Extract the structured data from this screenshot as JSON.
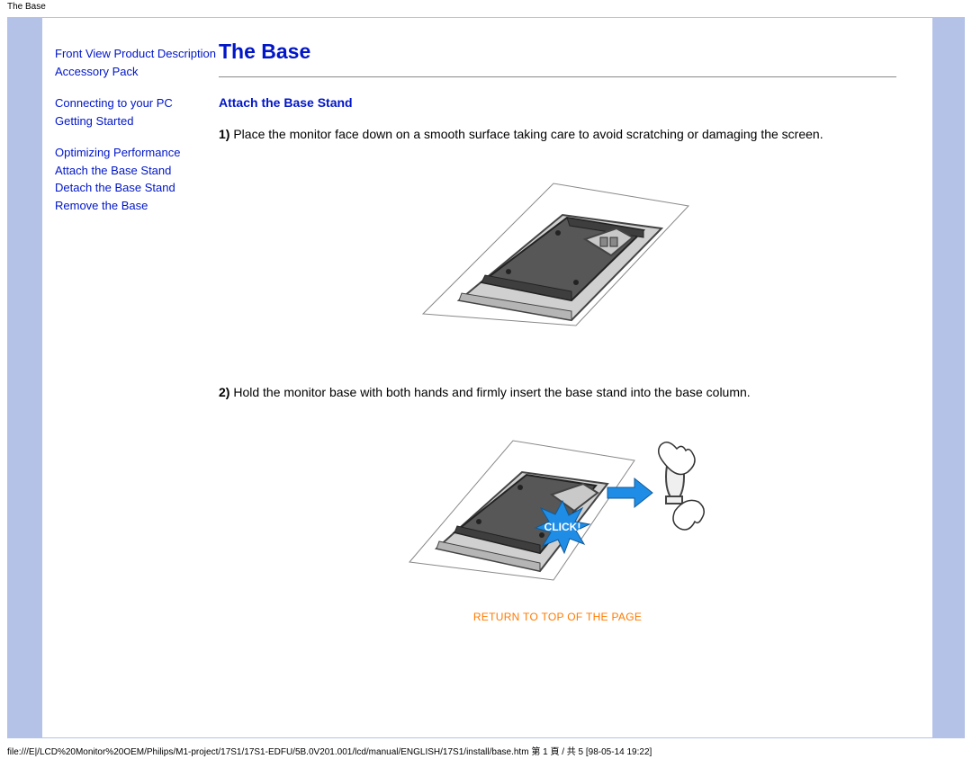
{
  "header": {
    "label": "The Base"
  },
  "sidebar": {
    "groups": [
      [
        {
          "label": "Front View Product Description"
        },
        {
          "label": "Accessory Pack"
        }
      ],
      [
        {
          "label": "Connecting to your PC"
        },
        {
          "label": "Getting Started"
        }
      ],
      [
        {
          "label": "Optimizing Performance"
        },
        {
          "label": "Attach the Base Stand"
        },
        {
          "label": "Detach the Base Stand"
        },
        {
          "label": "Remove the Base"
        }
      ]
    ]
  },
  "main": {
    "title": "The Base",
    "section_title": "Attach the Base Stand",
    "steps": [
      {
        "num": "1)",
        "text": "Place the monitor face down on a smooth surface taking care to avoid scratching or damaging the screen."
      },
      {
        "num": "2)",
        "text": "Hold the monitor base with both hands and firmly insert the base stand into the base column."
      }
    ],
    "click_label": "CLICK!",
    "return_link": "RETURN TO TOP OF THE PAGE"
  },
  "footer": {
    "path": "file:///E|/LCD%20Monitor%20OEM/Philips/M1-project/17S1/17S1-EDFU/5B.0V201.001/lcd/manual/ENGLISH/17S1/install/base.htm 第 1 頁 / 共 5  [98-05-14 19:22]"
  }
}
